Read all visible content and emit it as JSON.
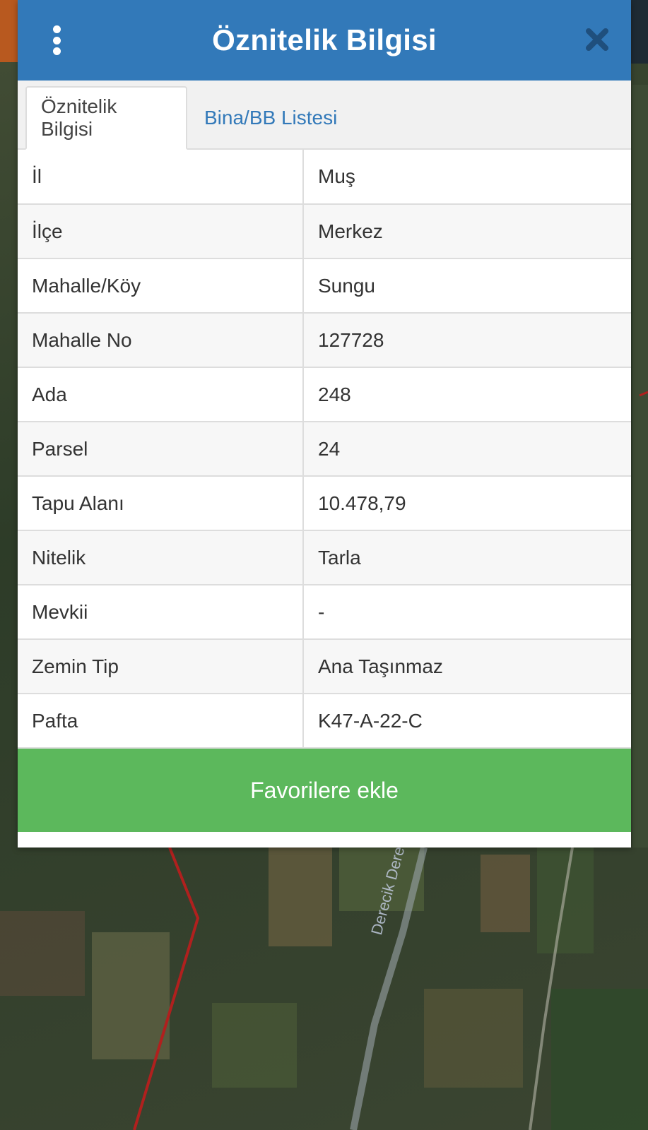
{
  "dialog": {
    "title": "Öznitelik Bilgisi"
  },
  "tabs": [
    {
      "label": "Öznitelik Bilgisi",
      "active": true
    },
    {
      "label": "Bina/BB Listesi",
      "active": false
    }
  ],
  "attributes": [
    {
      "key": "İl",
      "value": "Muş"
    },
    {
      "key": "İlçe",
      "value": "Merkez"
    },
    {
      "key": "Mahalle/Köy",
      "value": "Sungu"
    },
    {
      "key": "Mahalle No",
      "value": "127728"
    },
    {
      "key": "Ada",
      "value": "248"
    },
    {
      "key": "Parsel",
      "value": "24"
    },
    {
      "key": "Tapu Alanı",
      "value": "10.478,79"
    },
    {
      "key": "Nitelik",
      "value": "Tarla"
    },
    {
      "key": "Mevkii",
      "value": "-"
    },
    {
      "key": "Zemin Tip",
      "value": "Ana Taşınmaz"
    },
    {
      "key": "Pafta",
      "value": "K47-A-22-C"
    }
  ],
  "actions": {
    "favorite_label": "Favorilere ekle"
  },
  "map": {
    "stream_label": "Derecik Deresi"
  },
  "colors": {
    "header": "#3279b9",
    "tab_link": "#3279b9",
    "favorite_button": "#5cb85c",
    "parcel_border": "#b0201e"
  },
  "icons": {
    "menu": "vertical-dots-icon",
    "close": "close-x-icon"
  }
}
